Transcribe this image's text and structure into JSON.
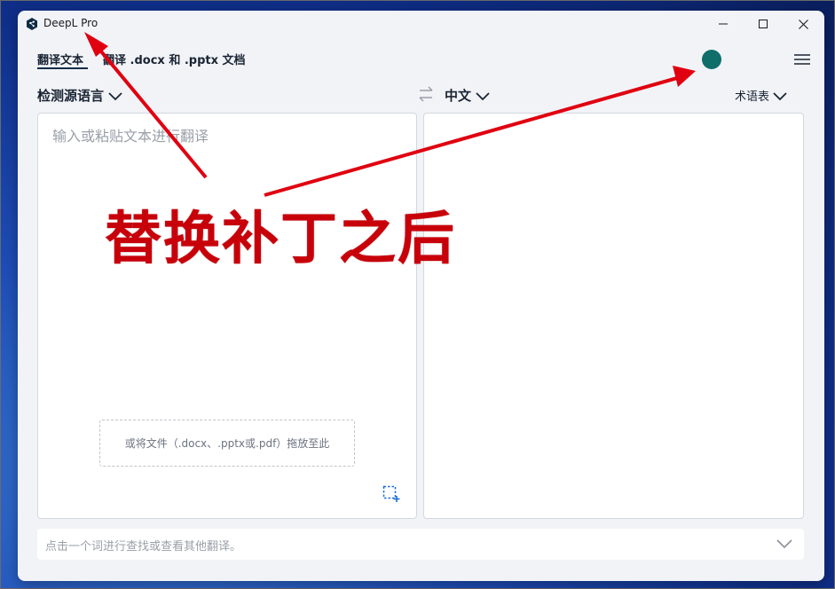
{
  "window": {
    "title": "DeepL Pro"
  },
  "tabs": [
    {
      "label": "翻译文本"
    },
    {
      "label": "翻译 .docx 和 .pptx 文档"
    }
  ],
  "languages": {
    "source": "检测源语言",
    "target": "中文",
    "glossary": "术语表"
  },
  "source_panel": {
    "placeholder": "输入或粘贴文本进行翻译",
    "drop_hint": "或将文件（.docx、.pptx或.pdf）拖放至此"
  },
  "dictionary": {
    "hint": "点击一个词进行查找或查看其他翻译。"
  },
  "annotation": {
    "text": "替换补丁之后",
    "color": "#e00010"
  },
  "colors": {
    "avatar": "#0f6e6a",
    "accent": "#0f2b46",
    "capture_icon": "#1a6fd4"
  }
}
